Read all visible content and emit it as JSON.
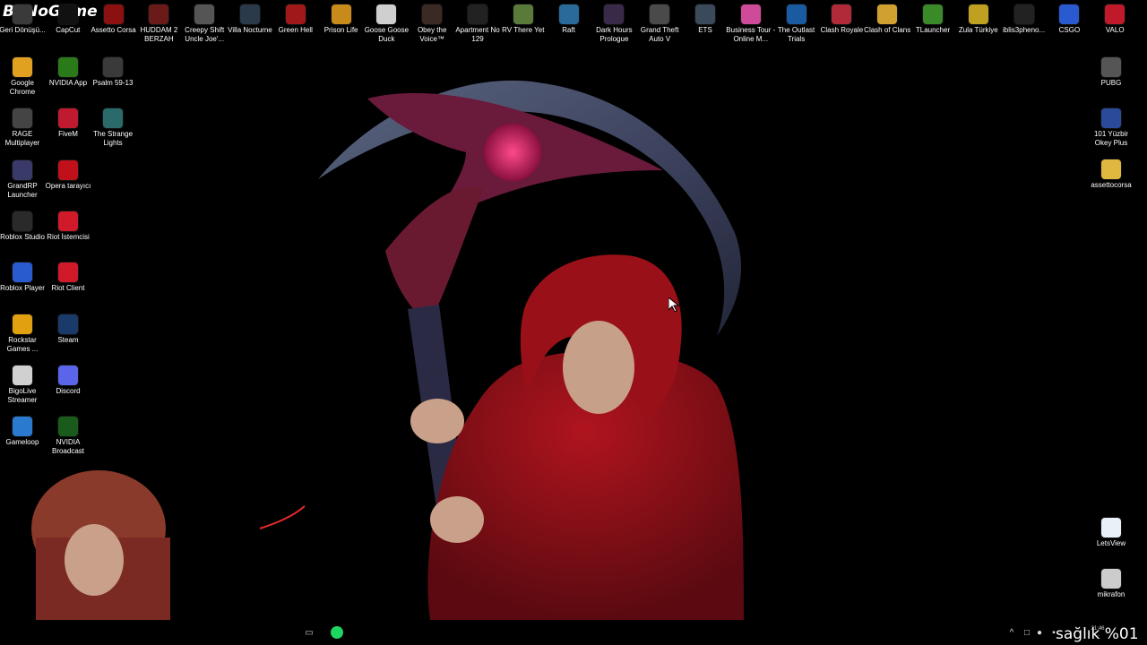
{
  "overlay": {
    "channel_logo": "BuNoGame",
    "health_text": "sağlık %01"
  },
  "taskbar": {
    "clock_time": "21:46",
    "clock_date": "..."
  },
  "desktop": {
    "top_row": [
      {
        "label": "Geri Dönüşü...",
        "icon": "recycle-bin-icon",
        "color": "#3a3a3a"
      },
      {
        "label": "CapCut",
        "icon": "capcut-icon",
        "color": "#111"
      },
      {
        "label": "Assetto Corsa",
        "icon": "assetto-corsa-icon",
        "color": "#8b1010"
      },
      {
        "label": "HUDDAM 2 BERZAH",
        "icon": "huddam-icon",
        "color": "#6b1a1a"
      },
      {
        "label": "Creepy Shift Uncle Joe'...",
        "icon": "creepy-shift-icon",
        "color": "#555"
      },
      {
        "label": "Villa Nocturne",
        "icon": "villa-nocturne-icon",
        "color": "#2a3a4a"
      },
      {
        "label": "Green Hell",
        "icon": "green-hell-icon",
        "color": "#a01818"
      },
      {
        "label": "Prison Life",
        "icon": "prison-life-icon",
        "color": "#c88a1a"
      },
      {
        "label": "Goose Goose Duck",
        "icon": "goose-duck-icon",
        "color": "#cfcfcf"
      },
      {
        "label": "Obey the Voice™",
        "icon": "obey-voice-icon",
        "color": "#3b2a24"
      },
      {
        "label": "Apartment No 129",
        "icon": "apartment-icon",
        "color": "#222"
      },
      {
        "label": "RV There Yet",
        "icon": "rv-there-icon",
        "color": "#5a7a3a"
      },
      {
        "label": "Raft",
        "icon": "raft-icon",
        "color": "#2a6a9a"
      },
      {
        "label": "Dark Hours Prologue",
        "icon": "dark-hours-icon",
        "color": "#3a2a4a"
      },
      {
        "label": "Grand Theft Auto V",
        "icon": "gta-icon",
        "color": "#4a4a4a"
      },
      {
        "label": "ETS",
        "icon": "ets-icon",
        "color": "#3a4a5a"
      },
      {
        "label": "Business Tour - Online M...",
        "icon": "business-tour-icon",
        "color": "#d04a9a"
      },
      {
        "label": "The Outlast Trials",
        "icon": "outlast-icon",
        "color": "#1a5aa0"
      },
      {
        "label": "Clash Royale",
        "icon": "clash-royale-icon",
        "color": "#b02a3a"
      },
      {
        "label": "Clash of Clans",
        "icon": "clash-clans-icon",
        "color": "#d0a030"
      },
      {
        "label": "TLauncher",
        "icon": "tlauncher-icon",
        "color": "#3a8a2a"
      },
      {
        "label": "Zula Türkiye",
        "icon": "zula-icon",
        "color": "#c0a020"
      },
      {
        "label": "iblis3pheno...",
        "icon": "iblis-icon",
        "color": "#222"
      },
      {
        "label": "CSGO",
        "icon": "csgo-icon",
        "color": "#2a5ad0"
      },
      {
        "label": "VALO",
        "icon": "valorant-icon",
        "color": "#c01a2a"
      }
    ],
    "col1": [
      {
        "label": "Google Chrome",
        "icon": "chrome-icon",
        "color": "#e0a020"
      },
      {
        "label": "RAGE Multiplayer",
        "icon": "rage-mp-icon",
        "color": "#444"
      },
      {
        "label": "GrandRP Launcher",
        "icon": "grandrp-icon",
        "color": "#3a3a6a"
      },
      {
        "label": "Roblox Studio",
        "icon": "roblox-studio-icon",
        "color": "#2a2a2a"
      },
      {
        "label": "Roblox Player",
        "icon": "roblox-player-icon",
        "color": "#2a5ad0"
      },
      {
        "label": "Rockstar Games ...",
        "icon": "rockstar-icon",
        "color": "#e0a010"
      },
      {
        "label": "BigoLive Streamer",
        "icon": "bigolive-icon",
        "color": "#d0d0d0"
      },
      {
        "label": "Gameloop",
        "icon": "gameloop-icon",
        "color": "#2a7ad0"
      }
    ],
    "col2": [
      {
        "label": "NVIDIA App",
        "icon": "nvidia-app-icon",
        "color": "#2a7a1a"
      },
      {
        "label": "FiveM",
        "icon": "fivem-icon",
        "color": "#c01a30"
      },
      {
        "label": "Opera tarayıcı",
        "icon": "opera-icon",
        "color": "#c0101a"
      },
      {
        "label": "Riot İstemcisi",
        "icon": "riot-client-icon",
        "color": "#d01a2a"
      },
      {
        "label": "Riot Client",
        "icon": "riot-client-icon",
        "color": "#d01a2a"
      },
      {
        "label": "Steam",
        "icon": "steam-icon",
        "color": "#1a3a6a"
      },
      {
        "label": "Discord",
        "icon": "discord-icon",
        "color": "#5a65ea"
      },
      {
        "label": "NVIDIA Broadcast",
        "icon": "nvidia-broadcast-icon",
        "color": "#1a5a1a"
      }
    ],
    "col3": [
      {
        "label": "Psalm 59-13",
        "icon": "psalm-icon",
        "color": "#3a3a3a"
      },
      {
        "label": "The Strange Lights",
        "icon": "strange-lights-icon",
        "color": "#2a6a6a"
      }
    ],
    "right_col": [
      {
        "label": "PUBG",
        "icon": "pubg-icon",
        "color": "#555"
      },
      {
        "label": "101 Yüzbir Okey Plus",
        "icon": "okey-icon",
        "color": "#2a4a9a"
      },
      {
        "label": "assettocorsa",
        "icon": "folder-icon",
        "color": "#e0b840"
      },
      {
        "label": "LetsView",
        "icon": "letsview-icon",
        "color": "#e8f0f8"
      },
      {
        "label": "mikrafon",
        "icon": "mikrafon-icon",
        "color": "#ccc"
      }
    ]
  },
  "colors": {
    "accent": "#a0101a",
    "scythe": "#3a3a55",
    "hood": "#8a0f18"
  }
}
